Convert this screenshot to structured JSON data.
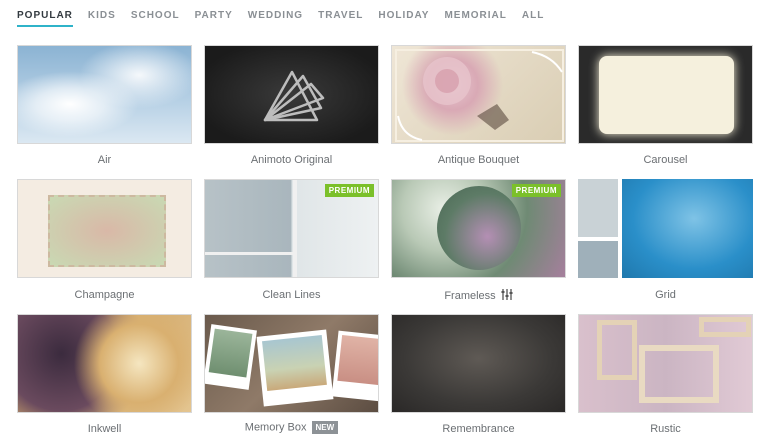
{
  "tabs": [
    {
      "label": "POPULAR",
      "active": true
    },
    {
      "label": "KIDS",
      "active": false
    },
    {
      "label": "SCHOOL",
      "active": false
    },
    {
      "label": "PARTY",
      "active": false
    },
    {
      "label": "WEDDING",
      "active": false
    },
    {
      "label": "TRAVEL",
      "active": false
    },
    {
      "label": "HOLIDAY",
      "active": false
    },
    {
      "label": "MEMORIAL",
      "active": false
    },
    {
      "label": "ALL",
      "active": false
    }
  ],
  "accent_color": "#2fb3c9",
  "badges": {
    "premium": "PREMIUM",
    "new": "NEW"
  },
  "themes": [
    {
      "name": "Air"
    },
    {
      "name": "Animoto Original"
    },
    {
      "name": "Antique Bouquet"
    },
    {
      "name": "Carousel"
    },
    {
      "name": "Champagne"
    },
    {
      "name": "Clean Lines",
      "badge": "premium"
    },
    {
      "name": "Frameless",
      "badge": "premium",
      "icon": "adjust-sliders-icon"
    },
    {
      "name": "Grid"
    },
    {
      "name": "Inkwell"
    },
    {
      "name": "Memory Box",
      "badge": "new"
    },
    {
      "name": "Remembrance"
    },
    {
      "name": "Rustic"
    }
  ]
}
